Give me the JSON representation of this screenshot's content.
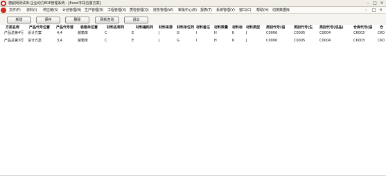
{
  "window": {
    "title": "德航网测试库-企业动力ERP管理系统 - [Excel字段位置方案]",
    "controls": [
      "–",
      "□",
      "×"
    ]
  },
  "menubar": {
    "items": [
      "文件(F)",
      "资料(I)",
      "供应链(S)",
      "计划管理(B)",
      "生产管理(R)",
      "工程管理(X)",
      "质检管理(Q)",
      "财务管理(W)",
      "审批中心(E)",
      "报表(T)",
      "系统管理(Y)",
      "窗口(C)",
      "帮助(H)",
      "切换数据库"
    ],
    "mdi_controls": [
      "–",
      "□",
      "×"
    ]
  },
  "toolbar": {
    "buttons": [
      "新增",
      "保存",
      "删除",
      "刷新查询",
      "退出"
    ]
  },
  "grid": {
    "headers": [
      "方案名称",
      "产品代号位置",
      "产品代号替",
      "装箱单位置",
      "材料名称列",
      "材料编码列",
      "材料来源",
      "材料单位列",
      "材料备注",
      "材料数量",
      "材料标",
      "材料类型",
      "类别代号(语",
      "类别代号(生",
      "类别代号(成品)",
      "仓库代号(语",
      "仓"
    ],
    "rows": [
      [
        "产品总第4行",
        "设计方案",
        "4,4",
        "装箱单",
        "C",
        "E",
        "J",
        "G",
        "I",
        "H",
        "K",
        "J",
        "C0006",
        "C0005",
        "C0004",
        "CK003",
        "CK0"
      ],
      [
        "产品总第3行",
        "设计方案",
        "3,4",
        "装箱单",
        "C",
        "E",
        "J",
        "G",
        "I",
        "H",
        "K",
        "J",
        "C0006",
        "C0005",
        "C0004",
        "CK003",
        "CK0"
      ]
    ]
  },
  "colors": {
    "titlebar_bg": "#f0eee6",
    "app_icon": "#c8201c",
    "menubar_bg": "#fbfaf6",
    "toolbar_bg": "#f5f4ef"
  }
}
